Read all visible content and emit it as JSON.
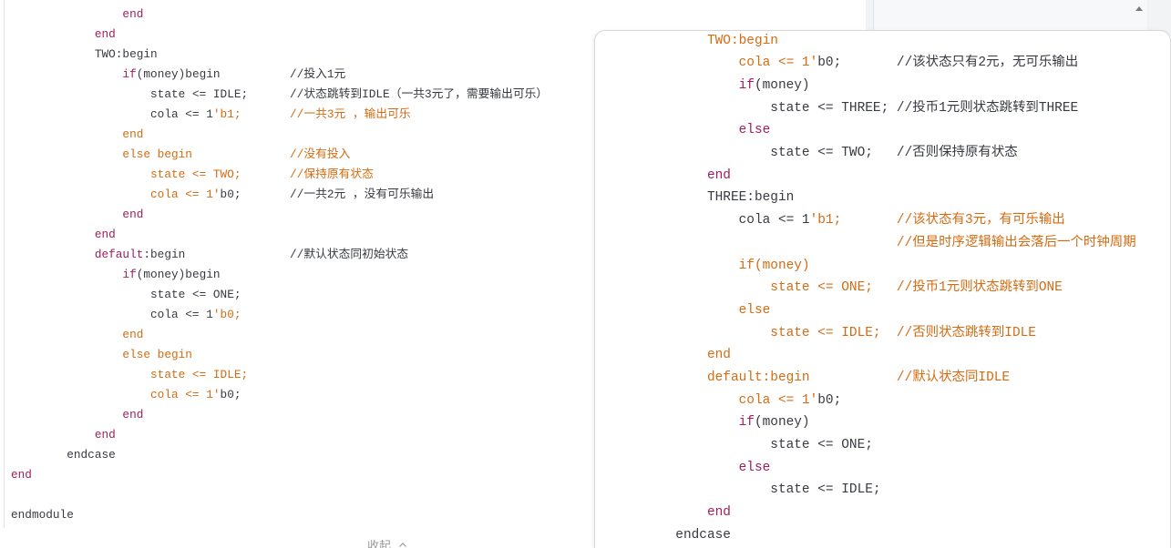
{
  "colors": {
    "text": "#383a42",
    "keyword": "#9d1f5f",
    "string": "#d46b12"
  },
  "left_code": {
    "lines": [
      {
        "tokens": [
          {
            "type": "keyword",
            "text": "                end"
          }
        ]
      },
      {
        "tokens": [
          {
            "type": "keyword",
            "text": "            end"
          }
        ]
      },
      {
        "tokens": [
          {
            "type": "text",
            "text": "            TWO:begin"
          }
        ]
      },
      {
        "tokens": [
          {
            "type": "keyword",
            "text": "                if"
          },
          {
            "type": "text",
            "text": "(money)begin          //投入1元"
          }
        ]
      },
      {
        "tokens": [
          {
            "type": "text",
            "text": "                    state <= IDLE;      //状态跳转到IDLE（一共3元了，需要输出可乐）"
          }
        ]
      },
      {
        "tokens": [
          {
            "type": "text",
            "text": "                    cola <= 1"
          },
          {
            "type": "string",
            "text": "'b1;       //一共3元 ，输出可乐"
          }
        ]
      },
      {
        "tokens": [
          {
            "type": "string",
            "text": "                end"
          }
        ]
      },
      {
        "tokens": [
          {
            "type": "string",
            "text": "                else begin              //没有投入"
          }
        ]
      },
      {
        "tokens": [
          {
            "type": "string",
            "text": "                    state <= TWO;       //保持原有状态"
          }
        ]
      },
      {
        "tokens": [
          {
            "type": "string",
            "text": "                    cola <= 1'"
          },
          {
            "type": "text",
            "text": "b0;       //一共2元 ，没有可乐输出"
          }
        ]
      },
      {
        "tokens": [
          {
            "type": "keyword",
            "text": "                end"
          }
        ]
      },
      {
        "tokens": [
          {
            "type": "keyword",
            "text": "            end"
          }
        ]
      },
      {
        "tokens": [
          {
            "type": "keyword",
            "text": "            default"
          },
          {
            "type": "text",
            "text": ":begin               //默认状态同初始状态"
          }
        ]
      },
      {
        "tokens": [
          {
            "type": "keyword",
            "text": "                if"
          },
          {
            "type": "text",
            "text": "(money)begin"
          }
        ]
      },
      {
        "tokens": [
          {
            "type": "text",
            "text": "                    state <= ONE;"
          }
        ]
      },
      {
        "tokens": [
          {
            "type": "text",
            "text": "                    cola <= 1"
          },
          {
            "type": "string",
            "text": "'b0;"
          }
        ]
      },
      {
        "tokens": [
          {
            "type": "string",
            "text": "                end"
          }
        ]
      },
      {
        "tokens": [
          {
            "type": "string",
            "text": "                else begin"
          }
        ]
      },
      {
        "tokens": [
          {
            "type": "string",
            "text": "                    state <= IDLE;"
          }
        ]
      },
      {
        "tokens": [
          {
            "type": "string",
            "text": "                    cola <= 1'"
          },
          {
            "type": "text",
            "text": "b0;"
          }
        ]
      },
      {
        "tokens": [
          {
            "type": "keyword",
            "text": "                end"
          }
        ]
      },
      {
        "tokens": [
          {
            "type": "keyword",
            "text": "            end"
          }
        ]
      },
      {
        "tokens": [
          {
            "type": "text",
            "text": "        endcase"
          }
        ]
      },
      {
        "tokens": [
          {
            "type": "keyword",
            "text": "end"
          }
        ]
      },
      {
        "tokens": []
      },
      {
        "tokens": [
          {
            "type": "text",
            "text": "endmodule"
          }
        ]
      }
    ]
  },
  "right_code": {
    "lines": [
      {
        "tokens": [
          {
            "type": "string",
            "text": "            TWO:begin"
          }
        ]
      },
      {
        "tokens": [
          {
            "type": "string",
            "text": "                cola <= 1'"
          },
          {
            "type": "text",
            "text": "b0;       //该状态只有2元，无可乐输出"
          }
        ]
      },
      {
        "tokens": [
          {
            "type": "keyword",
            "text": "                if"
          },
          {
            "type": "text",
            "text": "(money)"
          }
        ]
      },
      {
        "tokens": [
          {
            "type": "text",
            "text": "                    state <= THREE; //投币1元则状态跳转到THREE"
          }
        ]
      },
      {
        "tokens": [
          {
            "type": "keyword",
            "text": "                else"
          }
        ]
      },
      {
        "tokens": [
          {
            "type": "text",
            "text": "                    state <= TWO;   //否则保持原有状态"
          }
        ]
      },
      {
        "tokens": [
          {
            "type": "keyword",
            "text": "            end"
          }
        ]
      },
      {
        "tokens": [
          {
            "type": "text",
            "text": "            THREE:begin"
          }
        ]
      },
      {
        "tokens": [
          {
            "type": "text",
            "text": "                cola <= 1"
          },
          {
            "type": "string",
            "text": "'b1;       //该状态有3元，有可乐输出"
          }
        ]
      },
      {
        "tokens": [
          {
            "type": "string",
            "text": "                                    //但是时序逻辑输出会落后一个时钟周期"
          }
        ]
      },
      {
        "tokens": [
          {
            "type": "string",
            "text": "                if(money)"
          }
        ]
      },
      {
        "tokens": [
          {
            "type": "string",
            "text": "                    state <= ONE;   //投币1元则状态跳转到ONE"
          }
        ]
      },
      {
        "tokens": [
          {
            "type": "string",
            "text": "                else"
          }
        ]
      },
      {
        "tokens": [
          {
            "type": "string",
            "text": "                    state <= IDLE;  //否则状态跳转到IDLE"
          }
        ]
      },
      {
        "tokens": [
          {
            "type": "string",
            "text": "            end"
          }
        ]
      },
      {
        "tokens": [
          {
            "type": "string",
            "text": "            default:begin           //默认状态同IDLE"
          }
        ]
      },
      {
        "tokens": [
          {
            "type": "string",
            "text": "                cola <= 1'"
          },
          {
            "type": "text",
            "text": "b0;"
          }
        ]
      },
      {
        "tokens": [
          {
            "type": "keyword",
            "text": "                if"
          },
          {
            "type": "text",
            "text": "(money)"
          }
        ]
      },
      {
        "tokens": [
          {
            "type": "text",
            "text": "                    state <= ONE;"
          }
        ]
      },
      {
        "tokens": [
          {
            "type": "keyword",
            "text": "                else"
          }
        ]
      },
      {
        "tokens": [
          {
            "type": "text",
            "text": "                    state <= IDLE;"
          }
        ]
      },
      {
        "tokens": [
          {
            "type": "keyword",
            "text": "            end"
          }
        ]
      },
      {
        "tokens": [
          {
            "type": "text",
            "text": "        endcase"
          }
        ]
      }
    ]
  },
  "collapse": {
    "label": "收起",
    "icon": "chevron-up-icon"
  },
  "sidebar": {
    "scroll_icon": "scroll-up-icon"
  }
}
